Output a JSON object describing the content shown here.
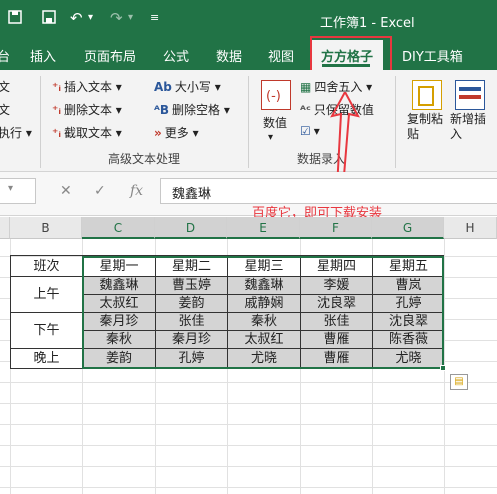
{
  "titlebar": {
    "title": "工作簿1 - Excel",
    "save_icon": "save-icon",
    "undo_icon": "undo-icon",
    "redo_icon": "redo-icon",
    "quick_access_icon": "quick-access-menu-icon"
  },
  "tabs": [
    {
      "label": "台"
    },
    {
      "label": "插入"
    },
    {
      "label": "页面布局"
    },
    {
      "label": "公式"
    },
    {
      "label": "数据"
    },
    {
      "label": "视图"
    },
    {
      "label": "方方格子",
      "active": true
    },
    {
      "label": "DIY工具箱"
    }
  ],
  "ribbon": {
    "left_partial": [
      "文",
      "文",
      "执行 ▾"
    ],
    "text_group": {
      "items": [
        "插入文本 ▾",
        "删除文本 ▾",
        "截取文本 ▾",
        "大小写 ▾",
        "删除空格 ▾",
        "更多 ▾"
      ],
      "label": "高级文本处理"
    },
    "number_group": {
      "big_label": "数值",
      "items": [
        "四舍五入 ▾",
        "只保留数值",
        "▾"
      ],
      "label": "数据录入"
    },
    "copy_label": "复制粘贴",
    "new_insert_label": "新增插入"
  },
  "formula_bar": {
    "fx": "fx",
    "value": "魏鑫琳"
  },
  "annotation": "百度它，即可下载安装",
  "columns": [
    "B",
    "C",
    "D",
    "E",
    "F",
    "G",
    "H"
  ],
  "sheet": {
    "header_row": [
      "班次",
      "星期一",
      "星期二",
      "星期三",
      "星期四",
      "星期五"
    ],
    "shift_labels": [
      "上午",
      "下午",
      "晚上"
    ],
    "rows": [
      [
        "魏鑫琳",
        "曹玉婷",
        "魏鑫琳",
        "李媛",
        "曹岚"
      ],
      [
        "太叔红",
        "姜韵",
        "戚静娴",
        "沈良翠",
        "孔婷"
      ],
      [
        "秦月珍",
        "张佳",
        "秦秋",
        "张佳",
        "沈良翠"
      ],
      [
        "秦秋",
        "秦月珍",
        "太叔红",
        "曹雁",
        "陈香薇"
      ],
      [
        "姜韵",
        "孔婷",
        "尤晓",
        "曹雁",
        "尤晓"
      ]
    ]
  },
  "colors": {
    "brand": "#217346",
    "annotation": "#e8373f",
    "highlight": "#d4d4d4"
  }
}
